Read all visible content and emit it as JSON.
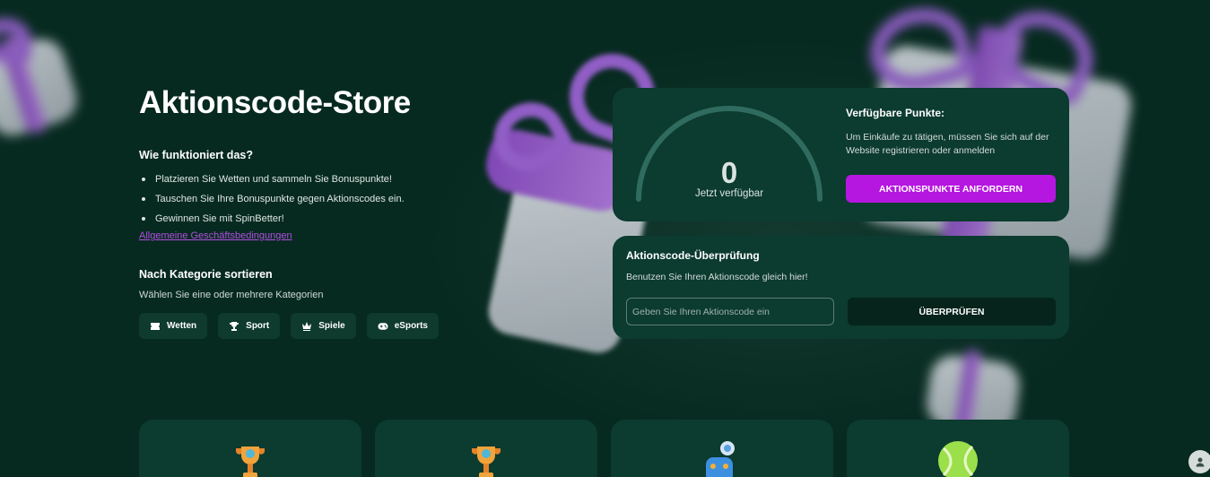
{
  "page": {
    "title": "Aktionscode-Store"
  },
  "how": {
    "title": "Wie funktioniert das?",
    "steps": [
      "Platzieren Sie Wetten und sammeln Sie Bonuspunkte!",
      "Tauschen Sie Ihre Bonuspunkte gegen Aktionscodes ein.",
      "Gewinnen Sie mit SpinBetter!"
    ],
    "terms_link": "Allgemeine Geschäftsbedingungen"
  },
  "sort": {
    "title": "Nach Kategorie sortieren",
    "subtitle": "Wählen Sie eine oder mehrere Kategorien",
    "categories": [
      {
        "label": "Wetten",
        "icon": "ticket-icon"
      },
      {
        "label": "Sport",
        "icon": "trophy-icon"
      },
      {
        "label": "Spiele",
        "icon": "crown-icon"
      },
      {
        "label": "eSports",
        "icon": "gamepad-icon"
      }
    ]
  },
  "points": {
    "value": "0",
    "value_label": "Jetzt verfügbar",
    "title": "Verfügbare Punkte:",
    "text": "Um Einkäufe zu tätigen, müssen Sie sich auf der Website registrieren oder anmelden",
    "request_button": "AKTIONSPUNKTE ANFORDERN"
  },
  "check": {
    "title": "Aktionscode-Überprüfung",
    "subtitle": "Benutzen Sie Ihren Aktionscode gleich hier!",
    "input_placeholder": "Geben Sie Ihren Aktionscode ein",
    "button": "ÜBERPRÜFEN"
  },
  "colors": {
    "background": "#072a20",
    "card": "#0c3b2f",
    "accent": "#b516e0",
    "link": "#b04fe0"
  }
}
